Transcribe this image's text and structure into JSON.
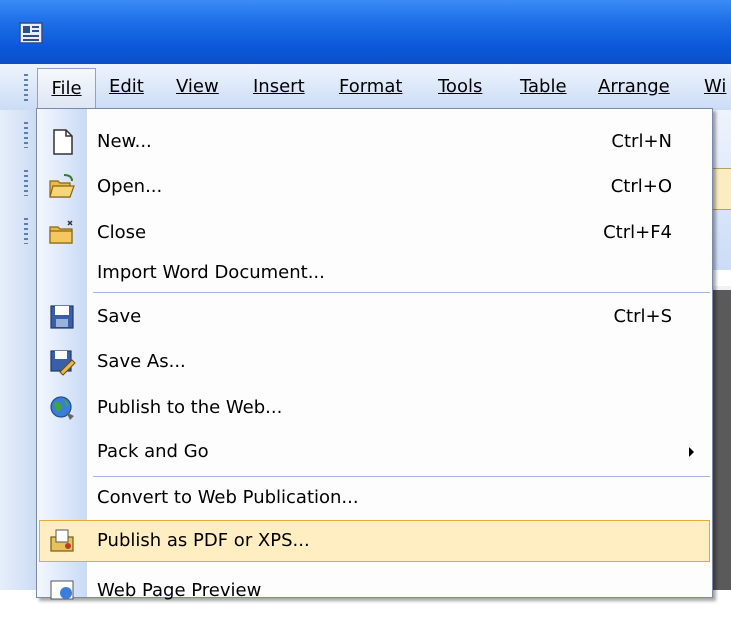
{
  "menubar": {
    "items": [
      {
        "label": "File",
        "open": true
      },
      {
        "label": "Edit"
      },
      {
        "label": "View"
      },
      {
        "label": "Insert"
      },
      {
        "label": "Format"
      },
      {
        "label": "Tools"
      },
      {
        "label": "Table"
      },
      {
        "label": "Arrange"
      },
      {
        "label": "Wi"
      }
    ]
  },
  "file_menu": {
    "items": [
      {
        "label": "New...",
        "shortcut": "Ctrl+N",
        "icon": "new-document-icon"
      },
      {
        "label": "Open...",
        "shortcut": "Ctrl+O",
        "icon": "open-folder-icon"
      },
      {
        "label": "Close",
        "shortcut": "Ctrl+F4",
        "icon": "close-folder-icon"
      },
      {
        "label": "Import Word Document...",
        "shortcut": ""
      },
      {
        "label": "Save",
        "shortcut": "Ctrl+S",
        "icon": "save-disk-icon"
      },
      {
        "label": "Save As...",
        "shortcut": "",
        "icon": "save-as-icon"
      },
      {
        "label": "Publish to the Web...",
        "shortcut": "",
        "icon": "globe-icon"
      },
      {
        "label": "Pack and Go",
        "shortcut": "",
        "submenu": true
      },
      {
        "label": "Convert to Web Publication...",
        "shortcut": ""
      },
      {
        "label": "Publish as PDF or XPS...",
        "shortcut": "",
        "icon": "pdf-export-icon",
        "highlighted": true
      },
      {
        "label": "Web Page Preview",
        "shortcut": "",
        "icon": "web-preview-icon"
      }
    ]
  },
  "colors": {
    "title_bar": "#0a58d8",
    "highlight": "#ffeec2",
    "highlight_border": "#e5a93f"
  }
}
